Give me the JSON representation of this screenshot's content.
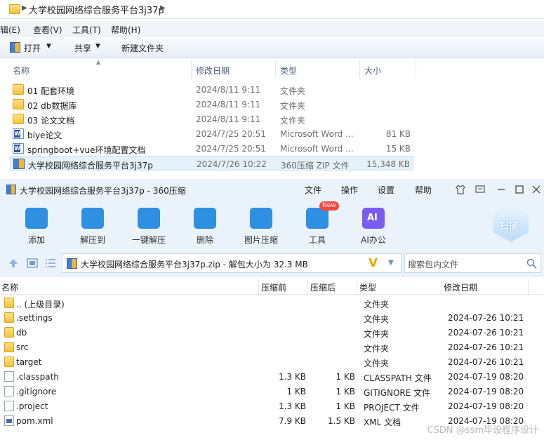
{
  "explorer": {
    "breadcrumb": "大学校园网络综合服务平台3j37p",
    "menu": [
      "辑(E)",
      "查看(V)",
      "工具(T)",
      "帮助(H)"
    ],
    "commands": {
      "open": "打开",
      "share": "共享",
      "new_folder": "新建文件夹"
    },
    "columns": {
      "name": "名称",
      "date": "修改日期",
      "type": "类型",
      "size": "大小"
    },
    "files": [
      {
        "name": "01 配套环境",
        "date": "2024/8/11 9:11",
        "type": "文件夹",
        "size": "",
        "icon": "folder-icon"
      },
      {
        "name": "02 db数据库",
        "date": "2024/8/11 9:11",
        "type": "文件夹",
        "size": "",
        "icon": "folder-icon"
      },
      {
        "name": "03 论文文档",
        "date": "2024/8/11 9:11",
        "type": "文件夹",
        "size": "",
        "icon": "folder-icon"
      },
      {
        "name": "biye论文",
        "date": "2024/7/25 20:51",
        "type": "Microsoft Word ...",
        "size": "81 KB",
        "icon": "word-doc-icon"
      },
      {
        "name": "springboot+vue环境配置文档",
        "date": "2024/7/25 20:51",
        "type": "Microsoft Word ...",
        "size": "15 KB",
        "icon": "word-doc-icon"
      },
      {
        "name": "大学校园网络综合服务平台3j37p",
        "date": "2024/7/26 10:22",
        "type": "360压缩 ZIP 文件",
        "size": "15,348 KB",
        "icon": "zip-archive-icon"
      }
    ]
  },
  "zip": {
    "title": "大学校园网络综合服务平台3j37p - 360压缩",
    "menu": [
      "文件",
      "操作",
      "设置",
      "帮助"
    ],
    "tools": [
      {
        "label": "添加",
        "icon": "add-icon",
        "color": "#2f8fe0"
      },
      {
        "label": "解压到",
        "icon": "extract-to-icon",
        "color": "#2f8fe0"
      },
      {
        "label": "一键解压",
        "icon": "one-click-extract-icon",
        "color": "#2f8fe0"
      },
      {
        "label": "删除",
        "icon": "delete-icon",
        "color": "#2f8fe0"
      },
      {
        "label": "图片压缩",
        "icon": "image-compress-icon",
        "color": "#2f8fe0"
      },
      {
        "label": "工具",
        "icon": "tools-icon",
        "color": "#2f8fe0"
      },
      {
        "label": "AI办公",
        "icon": "ai-office-icon",
        "color": "#7a5cf0"
      }
    ],
    "new_badge": "New",
    "ai_badge": "AI",
    "scan_label": "扫描",
    "path": "大学校园网络综合服务平台3j37p.zip - 解包大小为 32.3 MB",
    "search_placeholder": "搜索包内文件",
    "columns": {
      "name": "名称",
      "packed": "压缩前",
      "compressed": "压缩后",
      "type": "类型",
      "date": "修改日期"
    },
    "rows": [
      {
        "name": ".. (上级目录)",
        "orig": "",
        "comp": "",
        "type": "文件夹",
        "date": "",
        "icon": "folder-icon"
      },
      {
        "name": ".settings",
        "orig": "",
        "comp": "",
        "type": "文件夹",
        "date": "2024-07-26 10:21",
        "icon": "folder-icon"
      },
      {
        "name": "db",
        "orig": "",
        "comp": "",
        "type": "文件夹",
        "date": "2024-07-26 10:21",
        "icon": "folder-icon"
      },
      {
        "name": "src",
        "orig": "",
        "comp": "",
        "type": "文件夹",
        "date": "2024-07-26 10:21",
        "icon": "folder-icon"
      },
      {
        "name": "target",
        "orig": "",
        "comp": "",
        "type": "文件夹",
        "date": "2024-07-26 10:21",
        "icon": "folder-icon"
      },
      {
        "name": ".classpath",
        "orig": "1.3 KB",
        "comp": "1 KB",
        "type": "CLASSPATH 文件",
        "date": "2024-07-19 08:20",
        "icon": "file-icon"
      },
      {
        "name": ".gitignore",
        "orig": "1 KB",
        "comp": "1 KB",
        "type": "GITIGNORE 文件",
        "date": "2024-07-19 08:20",
        "icon": "file-icon"
      },
      {
        "name": ".project",
        "orig": "1.3 KB",
        "comp": "1 KB",
        "type": "PROJECT 文件",
        "date": "2024-07-19 08:20",
        "icon": "file-icon"
      },
      {
        "name": "pom.xml",
        "orig": "7.9 KB",
        "comp": "1.5 KB",
        "type": "XML 文档",
        "date": "2024-07-19 08:20",
        "icon": "xml-file-icon"
      }
    ],
    "watermark": "CSDN @ssm毕设程序设计"
  }
}
